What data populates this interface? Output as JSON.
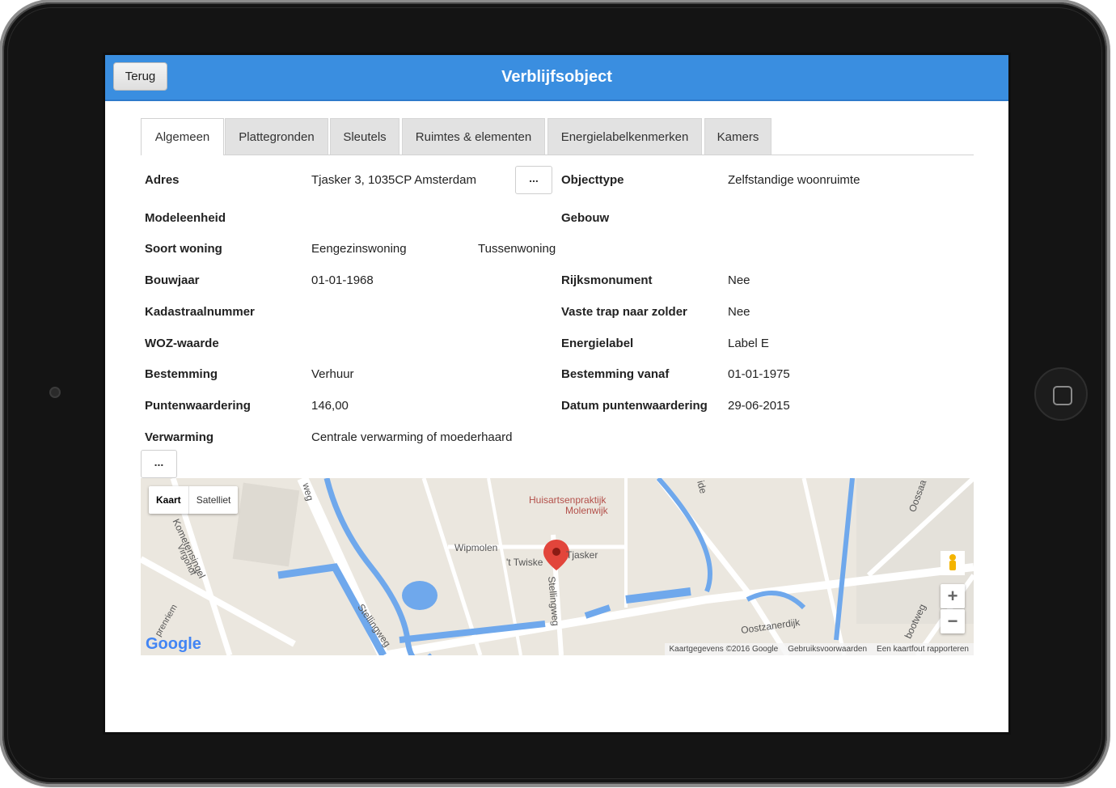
{
  "header": {
    "back_label": "Terug",
    "title": "Verblijfsobject"
  },
  "tabs": [
    {
      "label": "Algemeen"
    },
    {
      "label": "Plattegronden"
    },
    {
      "label": "Sleutels"
    },
    {
      "label": "Ruimtes & elementen"
    },
    {
      "label": "Energielabelkenmerken"
    },
    {
      "label": "Kamers"
    }
  ],
  "form": {
    "adres_label": "Adres",
    "adres_value": "Tjasker 3, 1035CP Amsterdam",
    "objecttype_label": "Objecttype",
    "objecttype_value": "Zelfstandige woonruimte",
    "modeleenheid_label": "Modeleenheid",
    "gebouw_label": "Gebouw",
    "soort_label": "Soort woning",
    "soort_value_1": "Eengezinswoning",
    "soort_value_2": "Tussenwoning",
    "bouwjaar_label": "Bouwjaar",
    "bouwjaar_value": "01-01-1968",
    "rijks_label": "Rijksmonument",
    "rijks_value": "Nee",
    "kadaster_label": "Kadastraalnummer",
    "trap_label": "Vaste trap naar zolder",
    "trap_value": "Nee",
    "woz_label": "WOZ-waarde",
    "energie_label": "Energielabel",
    "energie_value": "Label E",
    "bestemming_label": "Bestemming",
    "bestemming_value": "Verhuur",
    "bestemming_vanaf_label": "Bestemming vanaf",
    "bestemming_vanaf_value": "01-01-1975",
    "punten_label": "Puntenwaardering",
    "punten_value": "146,00",
    "datum_punten_label": "Datum puntenwaardering",
    "datum_punten_value": "29-06-2015",
    "verwarming_label": "Verwarming",
    "verwarming_value": "Centrale verwarming of moederhaard",
    "dots_label": "..."
  },
  "map": {
    "type_map": "Kaart",
    "type_satellite": "Satelliet",
    "zoom_in": "+",
    "zoom_out": "−",
    "labels": {
      "huisarts_1": "Huisartsenpraktijk",
      "huisarts_2": "Molenwijk",
      "wipmolen": "Wipmolen",
      "twiske": "'t Twiske",
      "tjasker": "Tjasker",
      "stellingweg_1": "Stellingweg",
      "stellingweg_2": "Stellingweg",
      "oostzanerdijk": "Oostzanerdijk",
      "kometensingel": "Kometensingel",
      "virgohof": "Virgohof",
      "weg_top": "weg",
      "ide": "ide",
      "oossaa": "Oossaa",
      "bootweg": "bootweg",
      "prenriem": "prenriem"
    },
    "attribution": {
      "data": "Kaartgegevens ©2016 Google",
      "terms": "Gebruiksvoorwaarden",
      "report": "Een kaartfout rapporteren"
    },
    "logo": "Google"
  },
  "colors": {
    "header": "#3a8ee0",
    "water": "#6fa8ec",
    "road": "#ffffff",
    "land": "#ebe7df",
    "marker": "#e2453b"
  }
}
